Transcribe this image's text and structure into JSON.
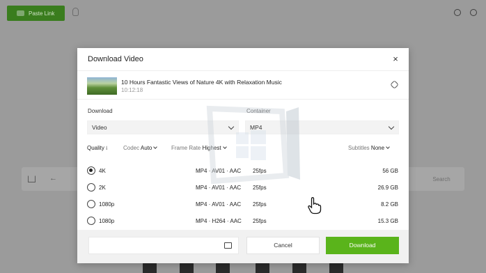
{
  "app": {
    "paste_link_label": "Paste Link",
    "search_label": "Search"
  },
  "modal": {
    "title": "Download Video",
    "close_label": "×",
    "video": {
      "title": "10 Hours Fantastic Views of Nature 4K with Relaxation Music",
      "duration": "10:12:18"
    },
    "download_label": "Download",
    "download_value": "Video",
    "container_label": "Container",
    "container_value": "MP4",
    "filters": {
      "quality_label": "Quality",
      "codec_label": "Codec",
      "codec_value": "Auto",
      "framerate_label": "Frame Rate",
      "framerate_value": "Highest",
      "subtitles_label": "Subtitles",
      "subtitles_value": "None"
    },
    "options": [
      {
        "res": "4K",
        "format": "MP4 · AV01 · AAC",
        "fps": "25fps",
        "size": "56 GB",
        "selected": true
      },
      {
        "res": "2K",
        "format": "MP4 · AV01 · AAC",
        "fps": "25fps",
        "size": "26.9 GB",
        "selected": false
      },
      {
        "res": "1080p",
        "format": "MP4 · AV01 · AAC",
        "fps": "25fps",
        "size": "8.2 GB",
        "selected": false
      },
      {
        "res": "1080p",
        "format": "MP4 · H264 · AAC",
        "fps": "25fps",
        "size": "15.3 GB",
        "selected": false
      }
    ],
    "footer": {
      "path_value": "",
      "cancel_label": "Cancel",
      "download_button_label": "Download"
    }
  },
  "colors": {
    "accent_green": "#5ab41b",
    "paste_green": "#3a7d1e",
    "overlay_gray": "#9b9b9b"
  }
}
